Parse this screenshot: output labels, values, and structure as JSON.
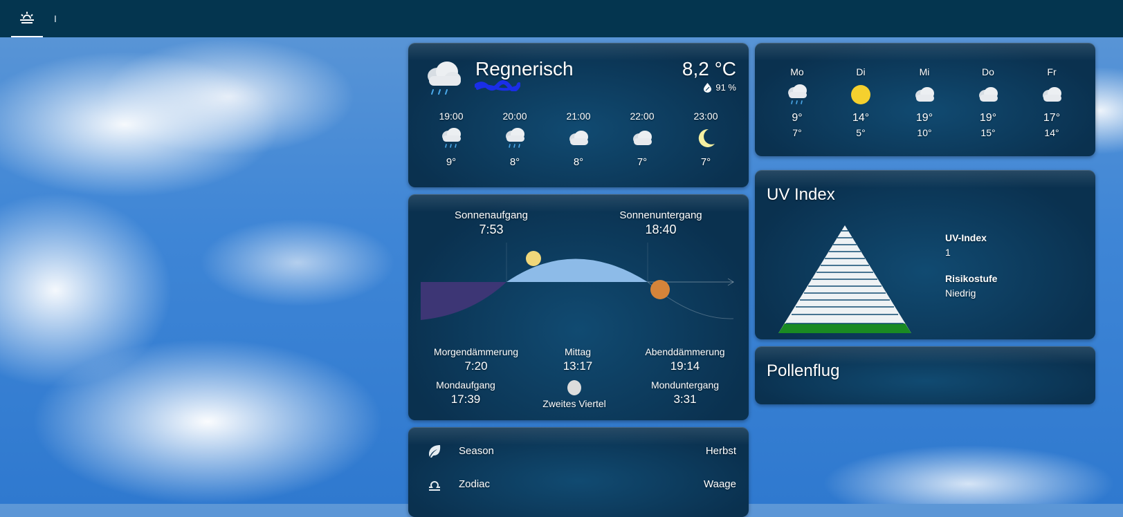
{
  "topbar": {
    "tabs": [
      {
        "icon": "weather-sunset-icon",
        "active": true
      },
      {
        "label": "I"
      }
    ],
    "accent": "#ffffff",
    "background": "#04354f"
  },
  "weather": {
    "condition": "Regnerisch",
    "temperature": "8,2 °C",
    "humidity": "91 %",
    "icon": "rainy-cloud-icon",
    "hourly": [
      {
        "time": "19:00",
        "temp": "9°",
        "icon": "rain"
      },
      {
        "time": "20:00",
        "temp": "8°",
        "icon": "rain"
      },
      {
        "time": "21:00",
        "temp": "8°",
        "icon": "cloud"
      },
      {
        "time": "22:00",
        "temp": "7°",
        "icon": "cloud"
      },
      {
        "time": "23:00",
        "temp": "7°",
        "icon": "moon"
      }
    ]
  },
  "forecast": {
    "days": [
      {
        "day": "Mo",
        "high": "9°",
        "low": "7°",
        "icon": "rain"
      },
      {
        "day": "Di",
        "high": "14°",
        "low": "5°",
        "icon": "sun"
      },
      {
        "day": "Mi",
        "high": "19°",
        "low": "10°",
        "icon": "cloud"
      },
      {
        "day": "Do",
        "high": "19°",
        "low": "15°",
        "icon": "cloud"
      },
      {
        "day": "Fr",
        "high": "17°",
        "low": "14°",
        "icon": "cloud"
      }
    ]
  },
  "sun": {
    "sunrise_label": "Sonnenaufgang",
    "sunrise": "7:53",
    "sunset_label": "Sonnenuntergang",
    "sunset": "18:40",
    "dawn_label": "Morgendämmerung",
    "dawn": "7:20",
    "noon_label": "Mittag",
    "noon": "13:17",
    "dusk_label": "Abenddämmerung",
    "dusk": "19:14",
    "moonrise_label": "Mondaufgang",
    "moonrise": "17:39",
    "moon_phase": "Zweites Viertel",
    "moonset_label": "Monduntergang",
    "moonset": "3:31",
    "colors": {
      "day_arc": "#8dbbe8",
      "night": "#3d3675",
      "sun": "#f0d77a",
      "sunset_dot": "#d5843a"
    }
  },
  "info_rows": [
    {
      "label": "Season",
      "value": "Herbst",
      "icon": "leaf-icon"
    },
    {
      "label": "Zodiac",
      "value": "Waage",
      "icon": "libra-icon"
    }
  ],
  "uv": {
    "title": "UV Index",
    "index_label": "UV-Index",
    "index_value": "1",
    "risk_label": "Risikostufe",
    "risk_value": "Niedrig",
    "level_color": "#1a8a22"
  },
  "pollen": {
    "title": "Pollenflug"
  }
}
